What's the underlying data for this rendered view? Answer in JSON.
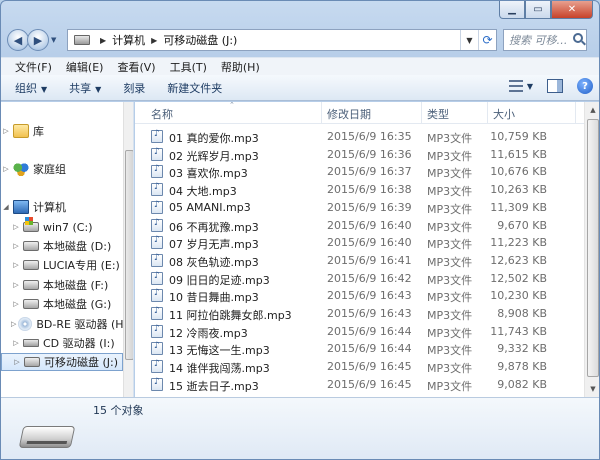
{
  "window": {
    "address_parts": [
      "计算机",
      "可移动磁盘 (J:)"
    ],
    "search_placeholder": "搜索 可移…"
  },
  "menu": [
    "文件(F)",
    "编辑(E)",
    "查看(V)",
    "工具(T)",
    "帮助(H)"
  ],
  "toolbar": {
    "organize": "组织",
    "share": "共享",
    "burn": "刻录",
    "new_folder": "新建文件夹"
  },
  "nav": {
    "library": "库",
    "homegroup": "家庭组",
    "computer": "计算机",
    "drives": [
      {
        "label": "win7 (C:)",
        "icon": "win-drive-icon"
      },
      {
        "label": "本地磁盘 (D:)",
        "icon": "drive-icon"
      },
      {
        "label": "LUCIA专用 (E:)",
        "icon": "drive-icon"
      },
      {
        "label": "本地磁盘 (F:)",
        "icon": "drive-icon"
      },
      {
        "label": "本地磁盘 (G:)",
        "icon": "drive-icon"
      },
      {
        "label": "BD-RE 驱动器 (H:)",
        "icon": "bd-icon"
      },
      {
        "label": "CD 驱动器 (I:)",
        "icon": "cd-icon"
      },
      {
        "label": "可移动磁盘 (J:)",
        "icon": "usb-drive-icon",
        "selected": true
      }
    ]
  },
  "columns": {
    "name": "名称",
    "date": "修改日期",
    "type": "类型",
    "size": "大小"
  },
  "files": [
    {
      "name": "01 真的爱你.mp3",
      "date": "2015/6/9 16:35",
      "type": "MP3文件",
      "size": "10,759 KB"
    },
    {
      "name": "02 光辉岁月.mp3",
      "date": "2015/6/9 16:36",
      "type": "MP3文件",
      "size": "11,615 KB"
    },
    {
      "name": "03 喜欢你.mp3",
      "date": "2015/6/9 16:37",
      "type": "MP3文件",
      "size": "10,676 KB"
    },
    {
      "name": "04 大地.mp3",
      "date": "2015/6/9 16:38",
      "type": "MP3文件",
      "size": "10,263 KB"
    },
    {
      "name": "05 AMANI.mp3",
      "date": "2015/6/9 16:39",
      "type": "MP3文件",
      "size": "11,309 KB"
    },
    {
      "name": "06 不再犹豫.mp3",
      "date": "2015/6/9 16:40",
      "type": "MP3文件",
      "size": "9,670 KB"
    },
    {
      "name": "07 岁月无声.mp3",
      "date": "2015/6/9 16:40",
      "type": "MP3文件",
      "size": "11,223 KB"
    },
    {
      "name": "08 灰色轨迹.mp3",
      "date": "2015/6/9 16:41",
      "type": "MP3文件",
      "size": "12,623 KB"
    },
    {
      "name": "09 旧日的足迹.mp3",
      "date": "2015/6/9 16:42",
      "type": "MP3文件",
      "size": "12,502 KB"
    },
    {
      "name": "10 昔日舞曲.mp3",
      "date": "2015/6/9 16:43",
      "type": "MP3文件",
      "size": "10,230 KB"
    },
    {
      "name": "11 阿拉伯跳舞女郎.mp3",
      "date": "2015/6/9 16:43",
      "type": "MP3文件",
      "size": "8,908 KB"
    },
    {
      "name": "12 冷雨夜.mp3",
      "date": "2015/6/9 16:44",
      "type": "MP3文件",
      "size": "11,743 KB"
    },
    {
      "name": "13 无悔这一生.mp3",
      "date": "2015/6/9 16:44",
      "type": "MP3文件",
      "size": "9,332 KB"
    },
    {
      "name": "14 谁伴我闯荡.mp3",
      "date": "2015/6/9 16:45",
      "type": "MP3文件",
      "size": "9,878 KB"
    },
    {
      "name": "15 逝去日子.mp3",
      "date": "2015/6/9 16:45",
      "type": "MP3文件",
      "size": "9,082 KB"
    }
  ],
  "details": {
    "count": "15 个对象"
  }
}
